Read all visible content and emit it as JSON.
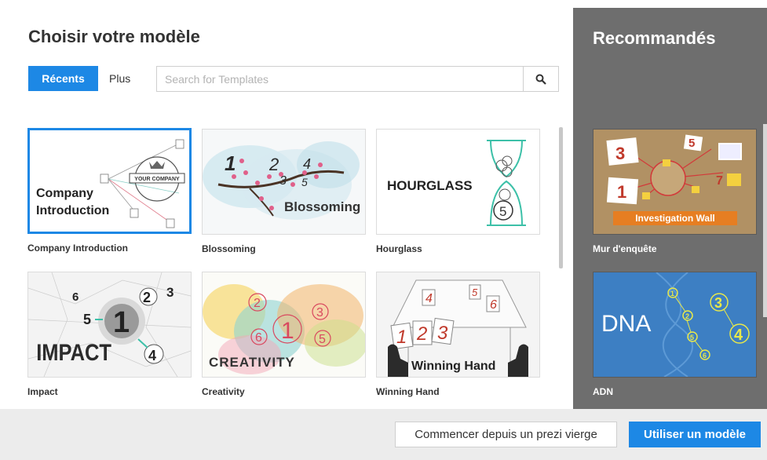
{
  "dialog": {
    "title": "Choisir votre modèle",
    "tabs": {
      "recent": "Récents",
      "more": "Plus"
    },
    "search": {
      "placeholder": "Search for Templates",
      "value": ""
    }
  },
  "templates": [
    {
      "label": "Company Introduction",
      "thumb_text": [
        "Company",
        "Introduction"
      ],
      "badge": "YOUR COMPANY",
      "selected": true
    },
    {
      "label": "Blossoming",
      "thumb_text": "Blossoming"
    },
    {
      "label": "Hourglass",
      "thumb_text": "HOURGLASS"
    },
    {
      "label": "Impact",
      "thumb_text": "IMPACT"
    },
    {
      "label": "Creativity",
      "thumb_text": "CREATIVITY"
    },
    {
      "label": "Winning Hand",
      "thumb_text": "Winning Hand"
    }
  ],
  "recommended": {
    "title": "Recommandés",
    "items": [
      {
        "label": "Mur d'enquête",
        "thumb_text": "Investigation Wall"
      },
      {
        "label": "ADN",
        "thumb_text": "DNA"
      }
    ]
  },
  "footer": {
    "blank_button": "Commencer depuis un prezi vierge",
    "use_button": "Utiliser un modèle"
  },
  "colors": {
    "accent": "#1d88e5",
    "sidebar": "#6e6e6e",
    "footer": "#ececec"
  }
}
